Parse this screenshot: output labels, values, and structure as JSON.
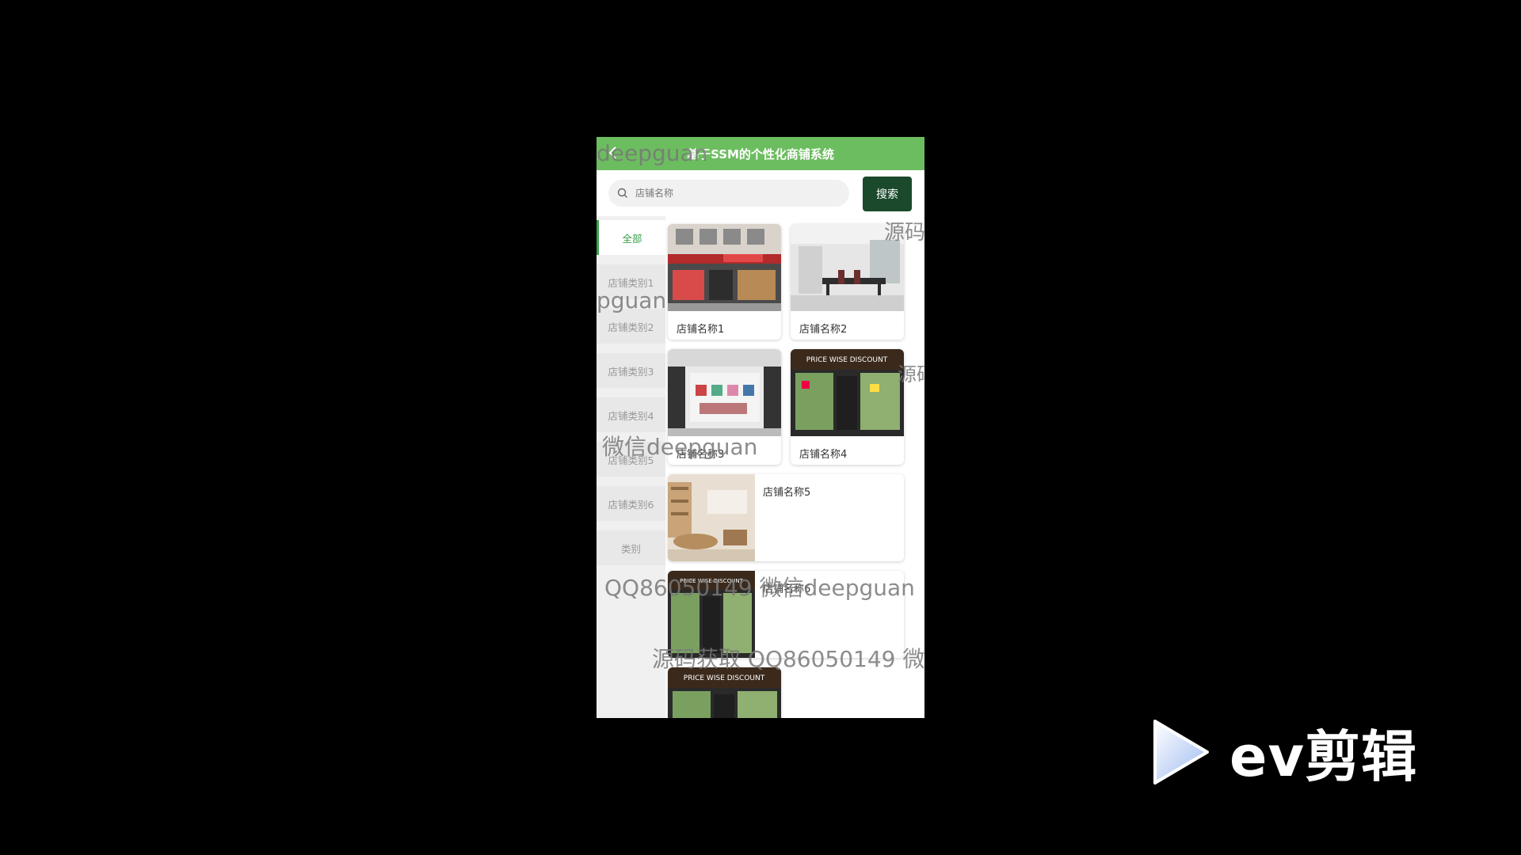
{
  "app": {
    "title": "基于SSM的个性化商铺系统"
  },
  "search": {
    "placeholder": "店铺名称",
    "button_label": "搜索"
  },
  "sidebar": {
    "items": [
      {
        "label": "全部",
        "active": true
      },
      {
        "label": "店铺类别1"
      },
      {
        "label": "店铺类别2"
      },
      {
        "label": "店铺类别3"
      },
      {
        "label": "店铺类别4"
      },
      {
        "label": "店铺类别5"
      },
      {
        "label": "店铺类别6"
      },
      {
        "label": "类别"
      }
    ]
  },
  "shops": [
    {
      "name": "店铺名称1"
    },
    {
      "name": "店铺名称2"
    },
    {
      "name": "店铺名称3"
    },
    {
      "name": "店铺名称4"
    },
    {
      "name": "店铺名称5"
    },
    {
      "name": "店铺名称6"
    }
  ],
  "store_sign": {
    "text": "PRICE WISE DISCOUNT"
  },
  "watermarks": [
    "deepguan",
    "源码",
    "pguan",
    "源码",
    "微信deepguan",
    "QQ86050149 微信deepguan",
    "源码获取 QQ86050149 微"
  ],
  "overlay": {
    "brand": "ev剪辑"
  },
  "colors": {
    "header": "#6cbd5f",
    "search_button": "#1a4a2b",
    "active_category": "#3aa14a",
    "background": "#000000"
  }
}
